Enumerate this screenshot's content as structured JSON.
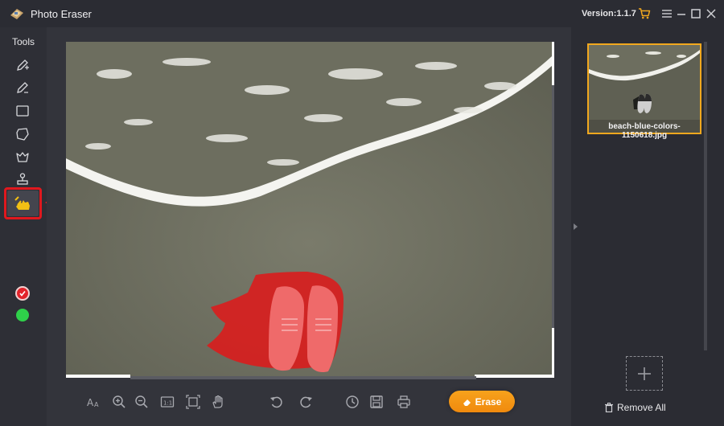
{
  "window": {
    "title": "Photo Eraser",
    "version": "Version:1.1.7"
  },
  "titlebar_icons": [
    "cart-icon",
    "menu-icon",
    "minimize-icon",
    "maximize-icon",
    "close-icon"
  ],
  "colors": {
    "accent": "#f2a81e",
    "highlight_red": "#e0181e",
    "mask_red": "#d81e1e",
    "status_green": "#2fd04a",
    "background": "#33343b"
  },
  "left_toolbar": {
    "label": "Tools",
    "tools": [
      {
        "name": "pencil-plus-icon"
      },
      {
        "name": "pencil-minus-icon"
      },
      {
        "name": "rectangle-select-icon"
      },
      {
        "name": "lasso-icon"
      },
      {
        "name": "polygon-lasso-icon"
      },
      {
        "name": "stamp-icon"
      },
      {
        "name": "hand-brush-icon",
        "active": true
      }
    ],
    "status_dots": [
      "red-check-icon",
      "green-dot-icon"
    ]
  },
  "bottom_toolbar": {
    "icons": [
      "text-size-icon",
      "zoom-in-icon",
      "zoom-out-icon",
      "actual-size-icon",
      "fit-icon",
      "hand-pan-icon",
      "undo-icon",
      "redo-icon",
      "history-icon",
      "save-icon",
      "print-icon"
    ],
    "erase_label": "Erase"
  },
  "right_panel": {
    "files": [
      {
        "name": "beach-blue-colors-1150618.jpg",
        "selected": true
      }
    ],
    "remove_all_label": "Remove All"
  }
}
